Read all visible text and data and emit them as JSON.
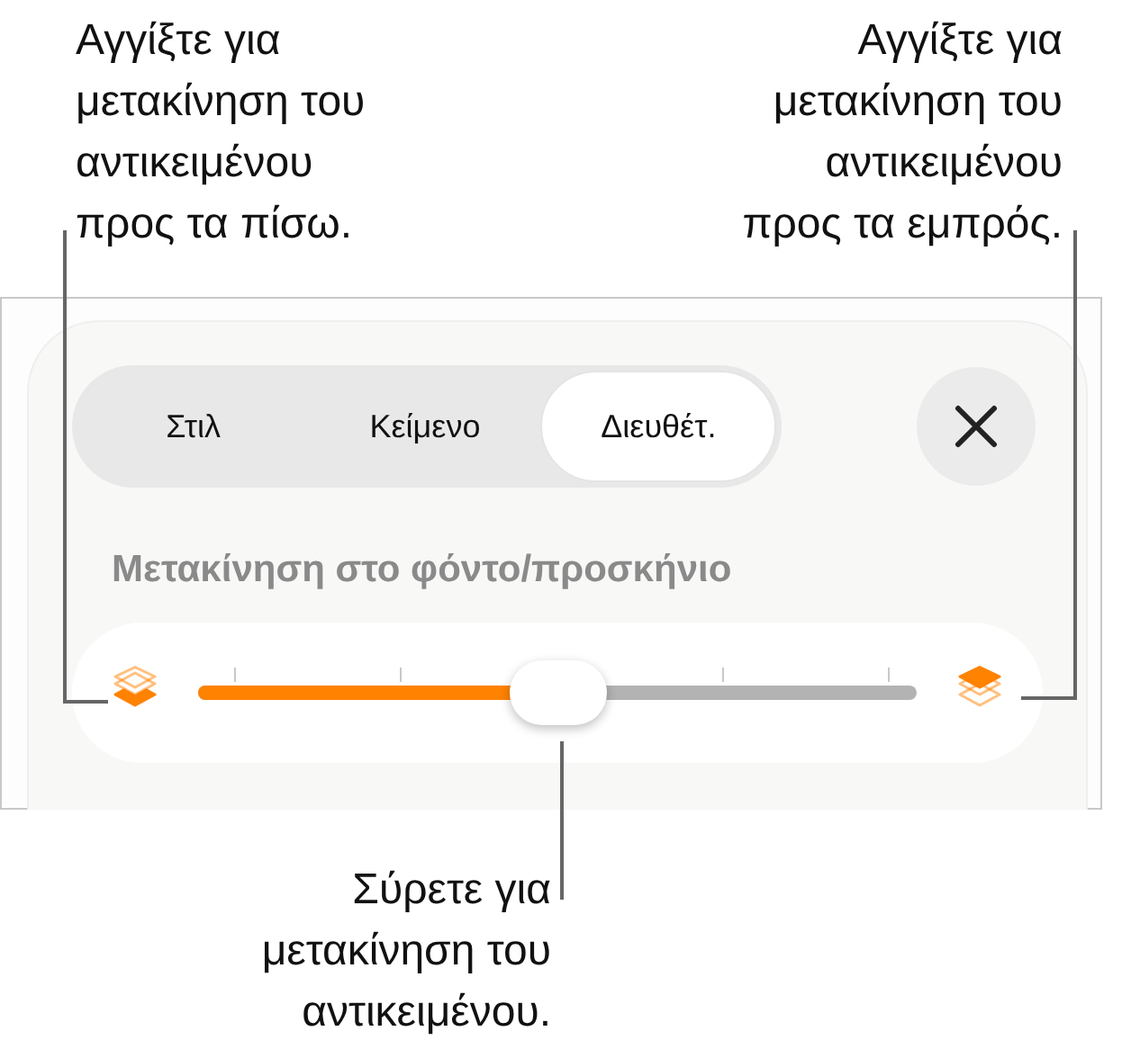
{
  "callouts": [
    {
      "kind": "back",
      "lines": [
        "Αγγίξτε για",
        "μετακίνηση του",
        "αντικειμένου",
        "προς τα πίσω."
      ]
    },
    {
      "kind": "forward",
      "lines": [
        "Αγγίξτε για",
        "μετακίνηση του",
        "αντικειμένου",
        "προς τα εμπρός."
      ]
    },
    {
      "kind": "drag",
      "lines": [
        "Σύρετε για",
        "μετακίνηση του",
        "αντικειμένου."
      ]
    }
  ],
  "tabs": [
    {
      "label": "Στιλ",
      "selected": false
    },
    {
      "label": "Κείμενο",
      "selected": false
    },
    {
      "label": "Διευθέτ.",
      "selected": true
    }
  ],
  "section_title": "Μετακίνηση στο φόντο/προσκήνιο",
  "slider": {
    "level": 0.5
  }
}
